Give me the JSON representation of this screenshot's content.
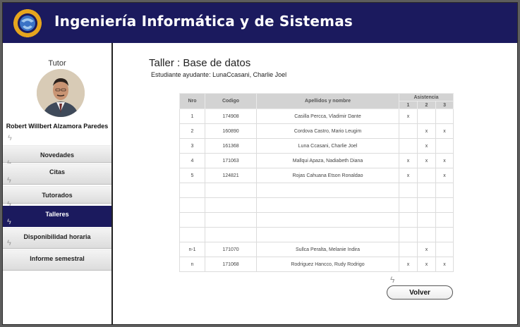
{
  "header": {
    "title": "Ingeniería Informática y de Sistemas"
  },
  "sidebar": {
    "tutor_label": "Tutor",
    "tutor_name": "Robert Willbert Alzamora Paredes",
    "items": [
      {
        "label": "Novedades"
      },
      {
        "label": "Citas"
      },
      {
        "label": "Tutorados"
      },
      {
        "label": "Talleres"
      },
      {
        "label": "Disponibilidad horaria"
      },
      {
        "label": "Informe semestral"
      }
    ],
    "active": "Talleres"
  },
  "main": {
    "title": "Taller : Base de datos",
    "assistant": "Estudiante ayudante: LunaCcasani, Charlie Joel",
    "table": {
      "headers": {
        "nro": "Nro",
        "codigo": "Codigo",
        "nombre": "Apellidos y nombre",
        "asistencia": "Asistencia",
        "sessions": [
          "1",
          "2",
          "3"
        ]
      },
      "rows": [
        {
          "nro": "1",
          "codigo": "174908",
          "nombre": "Casilla Percca, Vladimir Dante",
          "a": [
            "x",
            "",
            ""
          ]
        },
        {
          "nro": "2",
          "codigo": "160890",
          "nombre": "Cordova Castro, Mario Leugim",
          "a": [
            "",
            "x",
            "x"
          ]
        },
        {
          "nro": "3",
          "codigo": "161368",
          "nombre": "Luna Ccasani, Charlie Joel",
          "a": [
            "",
            "x",
            ""
          ]
        },
        {
          "nro": "4",
          "codigo": "171063",
          "nombre": "Mallqui Apaza, Nadiabeth Diana",
          "a": [
            "x",
            "x",
            "x"
          ]
        },
        {
          "nro": "5",
          "codigo": "124821",
          "nombre": "Rojas Cahuana Etson Ronaldao",
          "a": [
            "x",
            "",
            "x"
          ]
        },
        {
          "nro": "",
          "codigo": "",
          "nombre": "",
          "a": [
            "",
            "",
            ""
          ]
        },
        {
          "nro": "",
          "codigo": "",
          "nombre": "",
          "a": [
            "",
            "",
            ""
          ]
        },
        {
          "nro": "",
          "codigo": "",
          "nombre": "",
          "a": [
            "",
            "",
            ""
          ]
        },
        {
          "nro": "",
          "codigo": "",
          "nombre": "",
          "a": [
            "",
            "",
            ""
          ]
        },
        {
          "nro": "n-1",
          "codigo": "171070",
          "nombre": "Sullca Peralta, Melanie Indira",
          "a": [
            "",
            "x",
            ""
          ]
        },
        {
          "nro": "n",
          "codigo": "171068",
          "nombre": "Rodriguez Hancco, Rudy Rodrigo",
          "a": [
            "x",
            "x",
            "x"
          ]
        }
      ]
    },
    "back_button": "Volver"
  },
  "colors": {
    "brand": "#1b1a5e",
    "table_header": "#d3d3d3"
  }
}
